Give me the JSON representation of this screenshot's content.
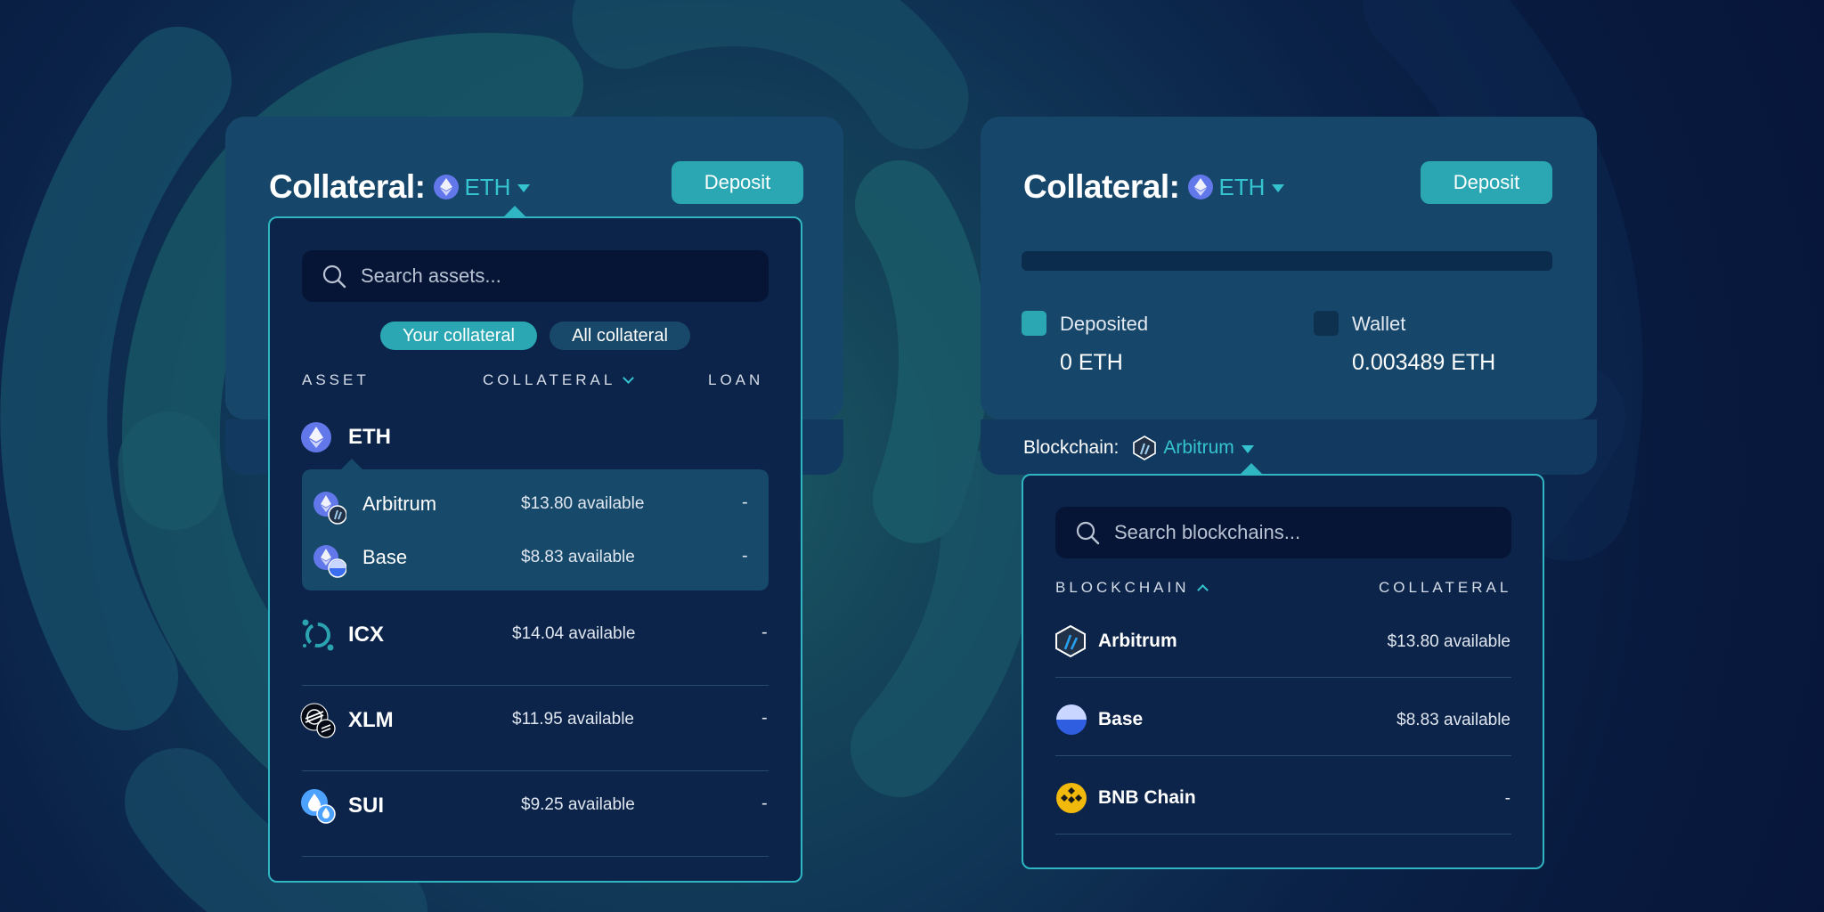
{
  "colors": {
    "accent": "#35c4cf",
    "button": "#2aa7b3",
    "panel_border": "#2fb6c2"
  },
  "left_card": {
    "title": "Collateral:",
    "asset": "ETH",
    "deposit_label": "Deposit",
    "dropdown": {
      "search_placeholder": "Search assets...",
      "filters": [
        "Your collateral",
        "All collateral"
      ],
      "active_filter": "Your collateral",
      "headers": {
        "asset": "ASSET",
        "collateral": "COLLATERAL",
        "loan": "LOAN"
      },
      "eth": {
        "name": "ETH",
        "chains": [
          {
            "name": "Arbitrum",
            "available": "$13.80 available",
            "loan": "-"
          },
          {
            "name": "Base",
            "available": "$8.83 available",
            "loan": "-"
          }
        ]
      },
      "assets": [
        {
          "name": "ICX",
          "available": "$14.04 available",
          "loan": "-",
          "icon": "icx-icon"
        },
        {
          "name": "XLM",
          "available": "$11.95 available",
          "loan": "-",
          "icon": "xlm-icon"
        },
        {
          "name": "SUI",
          "available": "$9.25 available",
          "loan": "-",
          "icon": "sui-icon"
        }
      ]
    }
  },
  "right_card": {
    "title": "Collateral:",
    "asset": "ETH",
    "deposit_label": "Deposit",
    "deposited": {
      "label": "Deposited",
      "value": "0 ETH"
    },
    "wallet": {
      "label": "Wallet",
      "value": "0.003489 ETH"
    },
    "deposited_fraction": 0,
    "blockchain_label": "Blockchain:",
    "blockchain_selected": "Arbitrum",
    "dropdown": {
      "search_placeholder": "Search blockchains...",
      "headers": {
        "blockchain": "BLOCKCHAIN",
        "collateral": "COLLATERAL"
      },
      "chains": [
        {
          "name": "Arbitrum",
          "available": "$13.80 available",
          "icon": "arbitrum-icon"
        },
        {
          "name": "Base",
          "available": "$8.83 available",
          "icon": "base-icon"
        },
        {
          "name": "BNB Chain",
          "available": "-",
          "icon": "bnb-icon"
        }
      ]
    }
  }
}
